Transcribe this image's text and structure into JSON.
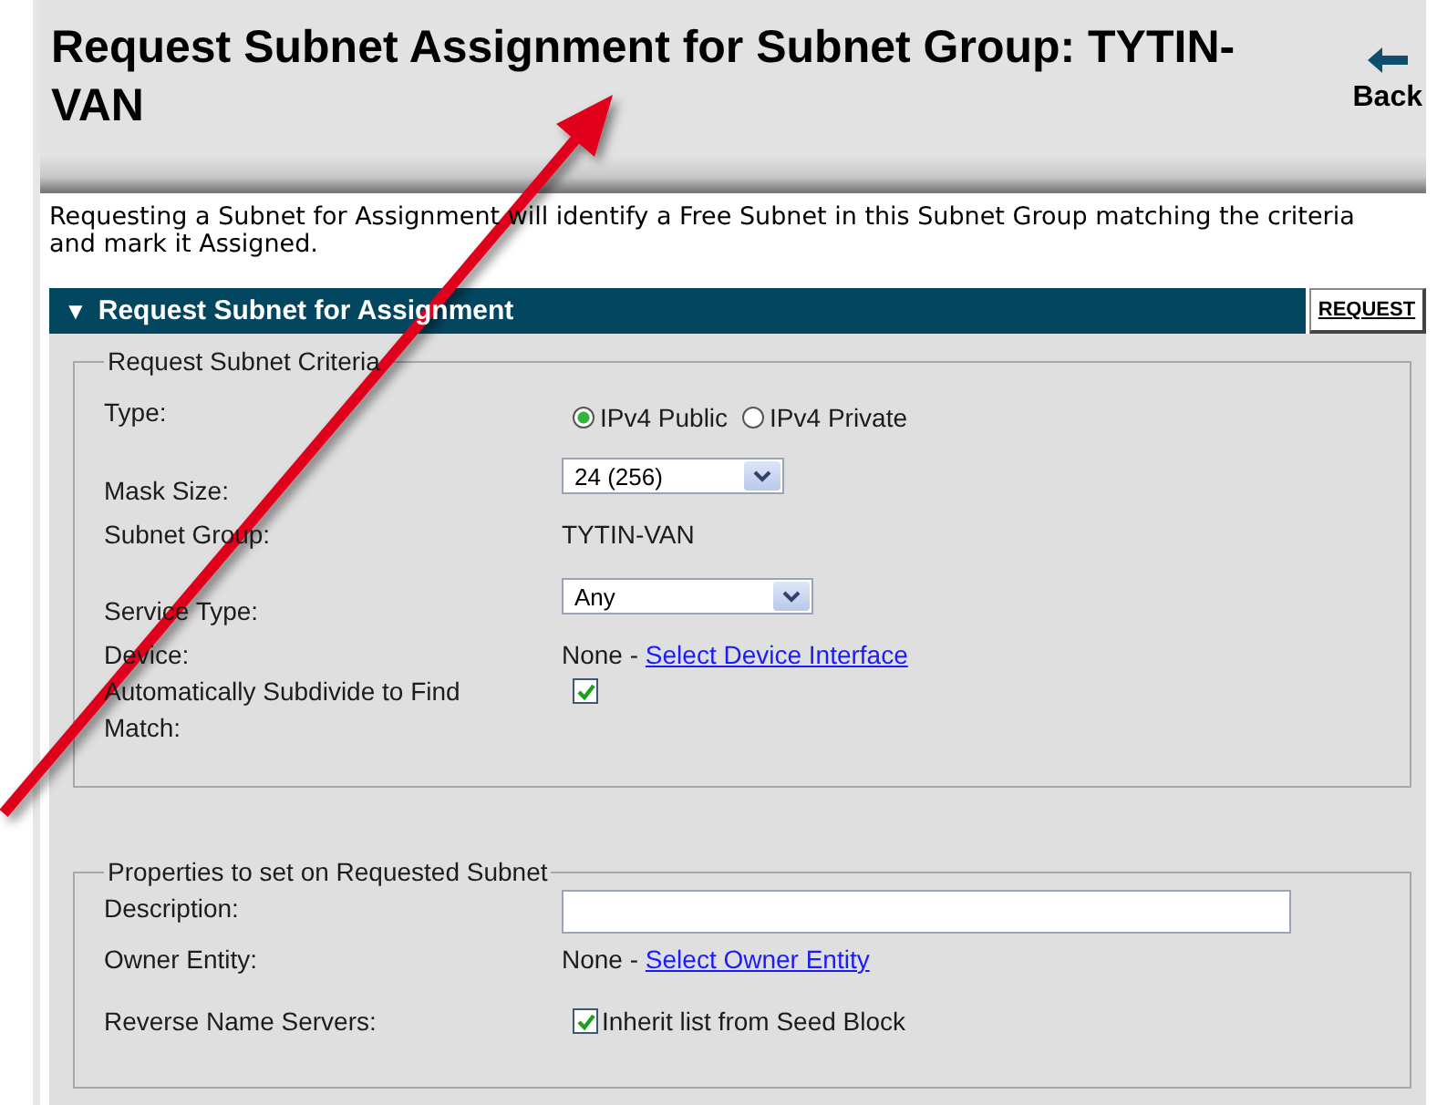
{
  "header": {
    "title": "Request Subnet Assignment for Subnet Group: TYTIN-VAN",
    "back": {
      "label": "Back"
    }
  },
  "intro": "Requesting a Subnet for Assignment will identify a Free Subnet in this Subnet Group matching the criteria and mark it Assigned.",
  "section": {
    "title": "Request Subnet for Assignment",
    "toggle": "▼",
    "expanded": true,
    "action": "REQUEST"
  },
  "fieldsets": [
    {
      "legend": "Request Subnet Criteria",
      "rows": [
        {
          "label": "Type:",
          "kind": "radio",
          "options": [
            {
              "label": "IPv4 Public",
              "selected": true
            },
            {
              "label": "IPv4 Private",
              "selected": false
            }
          ]
        },
        {
          "label": "Mask Size:",
          "kind": "select",
          "value": "24 (256)"
        },
        {
          "label": "Subnet Group:",
          "kind": "text",
          "value": "TYTIN-VAN"
        },
        {
          "label": "Service Type:",
          "kind": "select",
          "value": "Any"
        },
        {
          "label": "Device:",
          "kind": "link",
          "value": "None - ",
          "link": "Select Device Interface"
        },
        {
          "label": "Automatically Subdivide to Find Match:",
          "kind": "checkbox",
          "checked": true
        }
      ]
    },
    {
      "legend": "Properties to set on Requested Subnet",
      "rows": [
        {
          "label": "Description:",
          "kind": "input"
        },
        {
          "label": "Owner Entity:",
          "kind": "link",
          "value": "None - ",
          "link": "Select Owner Entity"
        },
        {
          "label": "Reverse Name Servers:",
          "kind": "checkbox",
          "checked": true,
          "text": "Inherit list from Seed Block"
        }
      ]
    }
  ]
}
